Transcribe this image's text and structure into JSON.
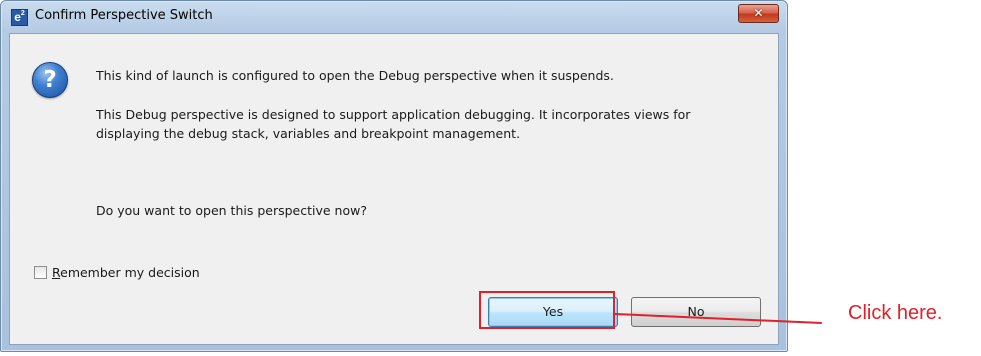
{
  "window": {
    "title": "Confirm Perspective Switch",
    "app_icon_text": "e",
    "app_icon_sup": "2",
    "close_glyph": "✕"
  },
  "icons": {
    "app": "e2-studio-icon",
    "message": "question-icon",
    "close": "close-icon"
  },
  "message": {
    "line1": "This kind of launch is configured to open the Debug perspective when it suspends.",
    "paragraph2": "This Debug perspective is designed to support application debugging.  It incorporates views for displaying the debug stack, variables and breakpoint management.",
    "line3": "Do you want to open this perspective now?",
    "question_glyph": "?"
  },
  "remember": {
    "label": "Remember my decision",
    "checked": false
  },
  "buttons": {
    "yes_label": "Yes",
    "no_label": "No"
  },
  "annotation": {
    "callout_text": "Click here.",
    "color": "#e0202a"
  },
  "colors": {
    "frame": "#b5cbe4",
    "client": "#f0f0f0",
    "close_button": "#c2391d",
    "default_button": "#bee6fd"
  }
}
